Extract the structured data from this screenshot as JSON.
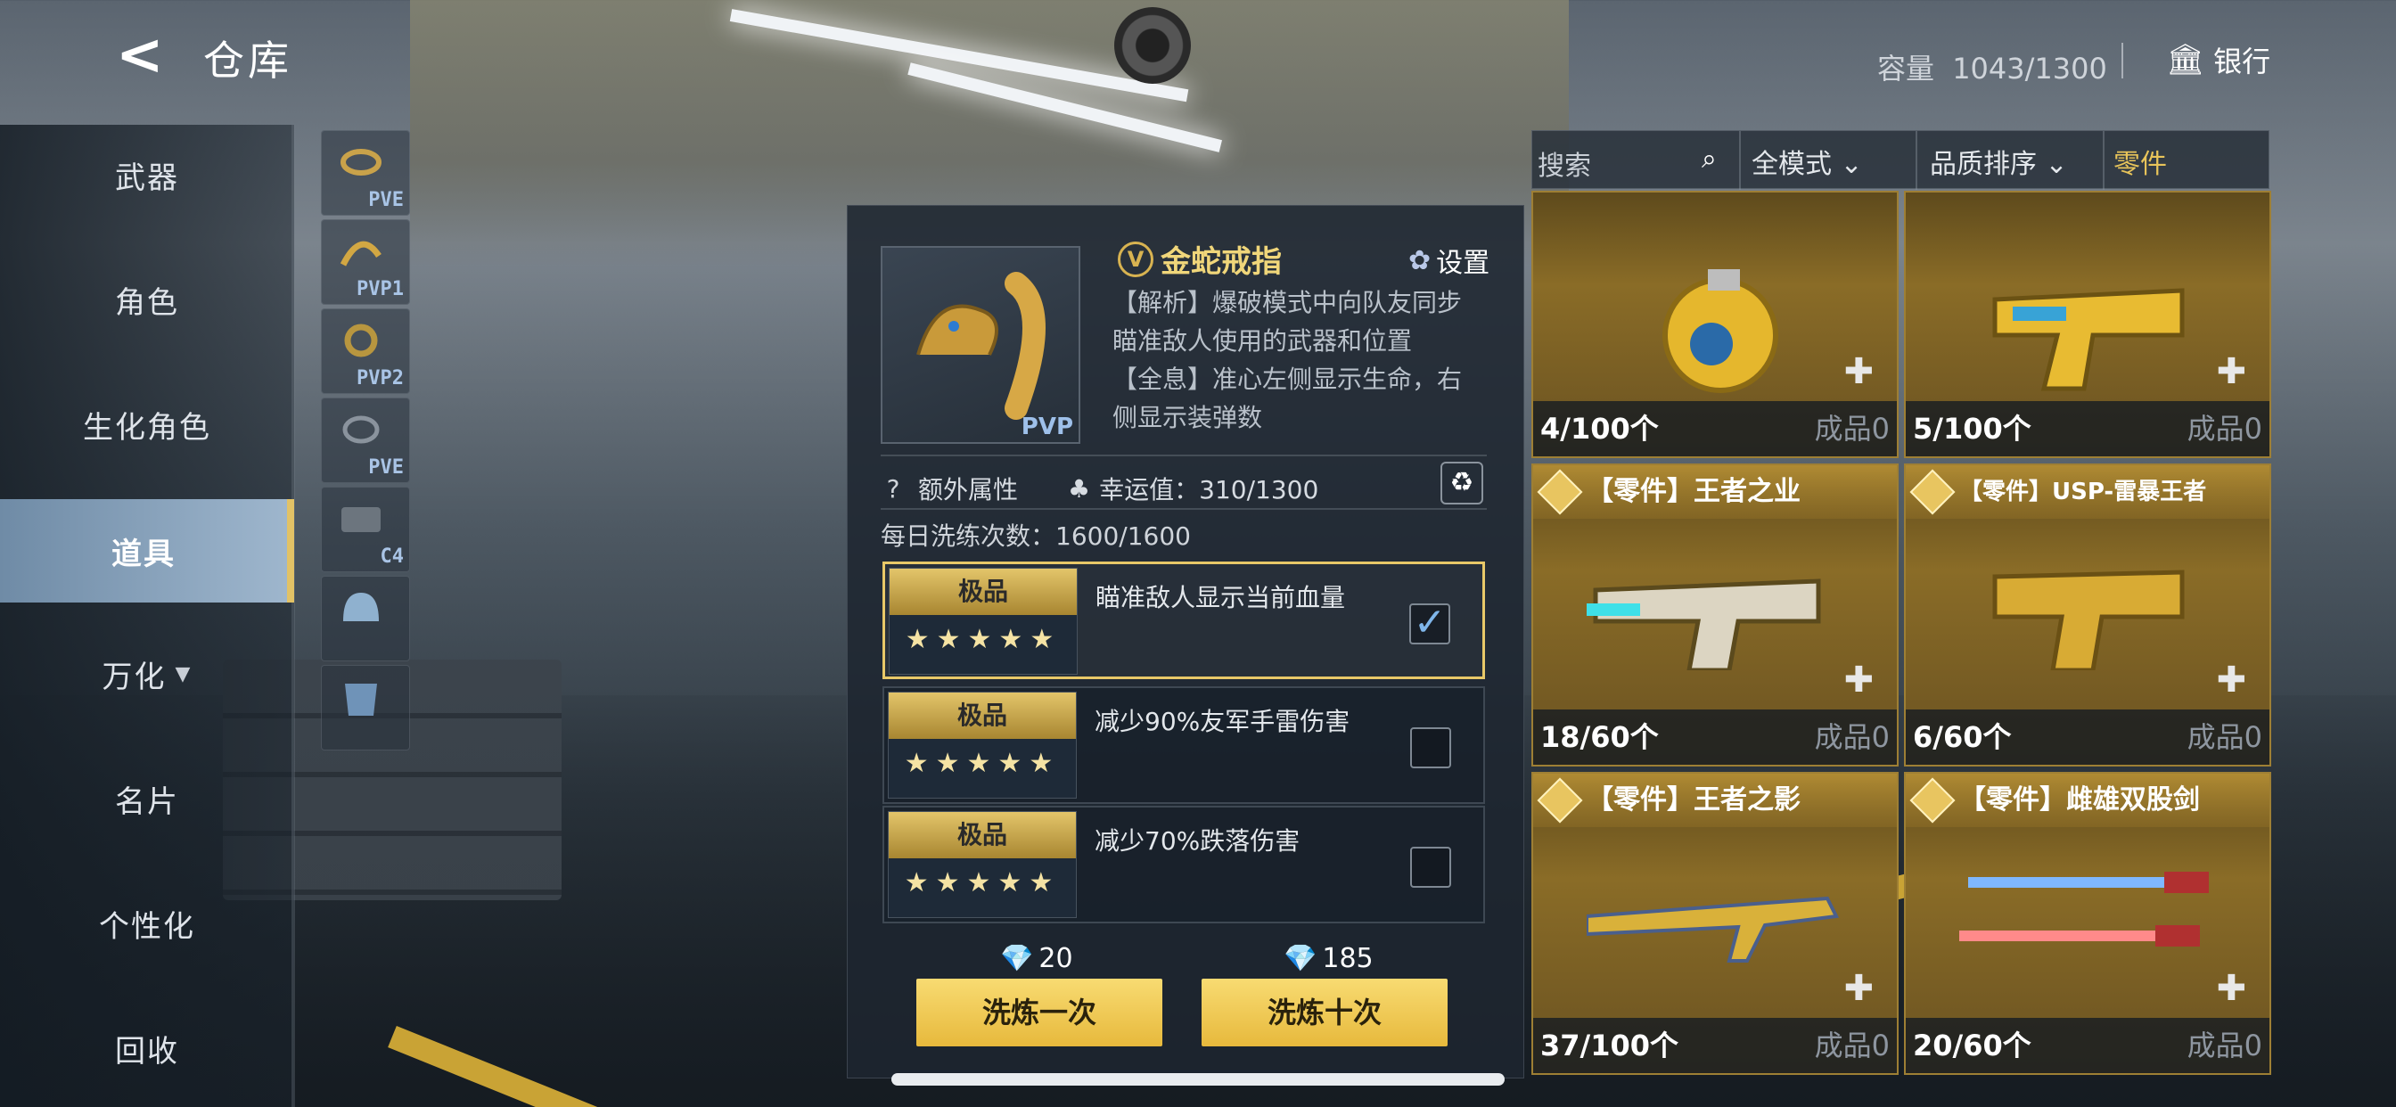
{
  "header": {
    "title": "仓库",
    "capacity_label": "容量",
    "capacity_value": "1043/1300",
    "bank_label": "银行"
  },
  "sidebar": {
    "items": [
      {
        "label": "武器"
      },
      {
        "label": "角色"
      },
      {
        "label": "生化角色"
      },
      {
        "label": "道具",
        "active": true
      },
      {
        "label": "万化"
      },
      {
        "label": "名片"
      },
      {
        "label": "个性化"
      },
      {
        "label": "回收"
      }
    ]
  },
  "item_column": [
    {
      "tag": "PVE"
    },
    {
      "tag": "PVP1"
    },
    {
      "tag": "PVP2"
    },
    {
      "tag": "PVE"
    },
    {
      "tag": "C4"
    },
    {
      "tag": ""
    },
    {
      "tag": ""
    }
  ],
  "detail": {
    "preview_tag": "PVP",
    "name": "金蛇戒指",
    "settings_label": "设置",
    "desc_lines": [
      "【解析】爆破模式中向队友同步",
      "瞄准敌人使用的武器和位置",
      "【全息】准心左侧显示生命，右",
      "侧显示装弹数"
    ],
    "extra_attr_label": "额外属性",
    "luck_label": "幸运值：310/1300",
    "daily_label": "每日洗练次数：1600/1600",
    "options": [
      {
        "tier": "极品",
        "stars": "★★★★★",
        "text": "瞄准敌人显示当前血量",
        "checked": true
      },
      {
        "tier": "极品",
        "stars": "★★★★★",
        "text": "减少90%友军手雷伤害",
        "checked": false
      },
      {
        "tier": "极品",
        "stars": "★★★★★",
        "text": "减少70%跌落伤害",
        "checked": false
      }
    ],
    "cost_once": "20",
    "cost_ten": "185",
    "btn_once": "洗炼一次",
    "btn_ten": "洗炼十次"
  },
  "filters": {
    "search_placeholder": "搜索",
    "mode": "全模式",
    "sort": "品质排序",
    "category": "零件"
  },
  "cards": [
    {
      "title": "",
      "qty": "4/100个",
      "made": "成品0"
    },
    {
      "title": "",
      "qty": "5/100个",
      "made": "成品0"
    },
    {
      "title": "【零件】王者之业",
      "qty": "18/60个",
      "made": "成品0"
    },
    {
      "title": "【零件】USP-雷暴王者",
      "qty": "6/60个",
      "made": "成品0"
    },
    {
      "title": "【零件】王者之影",
      "qty": "37/100个",
      "made": "成品0"
    },
    {
      "title": "【零件】雌雄双股剑",
      "qty": "20/60个",
      "made": "成品0"
    }
  ],
  "colors": {
    "accent_gold": "#e7b93c",
    "active_tab": "#9eb6cd",
    "card_gold": "#8a6c27"
  }
}
